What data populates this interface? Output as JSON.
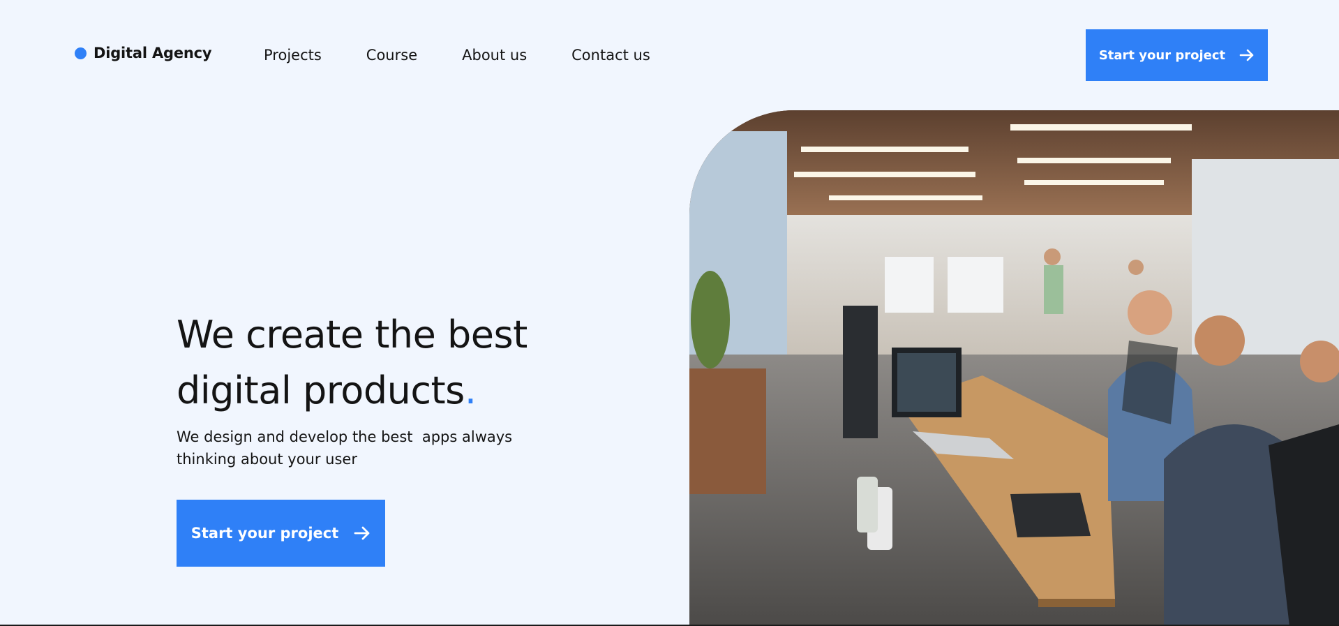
{
  "brand": {
    "name": "Digital Agency",
    "accent": "#2f80f7"
  },
  "nav": {
    "items": [
      "Projects",
      "Course",
      "About us",
      "Contact us"
    ]
  },
  "header_cta": {
    "label": "Start your project",
    "icon": "arrow-right-icon"
  },
  "hero": {
    "title_line1": "We create the best",
    "title_line2": "digital products",
    "title_dot": ".",
    "subtitle_line1": "We design and develop the best  apps always",
    "subtitle_line2": "thinking about your user",
    "cta_label": "Start your project"
  },
  "photo": {
    "subject": "office workspace with people at desks"
  }
}
